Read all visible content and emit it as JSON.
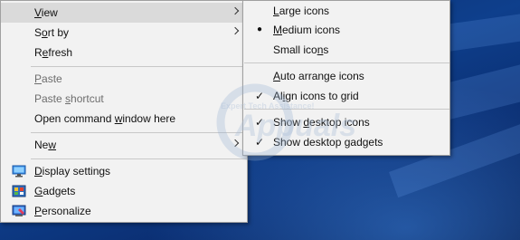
{
  "context_menu": {
    "items": [
      {
        "label": "View",
        "mn": "V",
        "rest": "iew",
        "arrow": true,
        "hover": true
      },
      {
        "label": "Sort by",
        "mn": "o",
        "pre": "S",
        "rest": "rt by",
        "arrow": true
      },
      {
        "label": "Refresh",
        "mn": "e",
        "pre": "R",
        "rest": "fresh"
      },
      {
        "label": "Paste",
        "mn": "P",
        "rest": "aste",
        "disabled": true
      },
      {
        "label": "Paste shortcut",
        "mn": "s",
        "pre": "Paste ",
        "rest": "hortcut",
        "disabled": true
      },
      {
        "label": "Open command window here",
        "mn": "w",
        "pre": "Open command ",
        "rest": "indow here"
      },
      {
        "label": "New",
        "mn": "w",
        "pre": "Ne",
        "rest": "",
        "arrow": true
      },
      {
        "label": "Display settings",
        "mn": "D",
        "rest": "isplay settings",
        "icon": "display-icon"
      },
      {
        "label": "Gadgets",
        "mn": "G",
        "rest": "adgets",
        "icon": "gadgets-icon"
      },
      {
        "label": "Personalize",
        "mn": "P",
        "rest": "ersonalize",
        "icon": "personalize-icon"
      }
    ]
  },
  "view_submenu": {
    "items": [
      {
        "label": "Large icons",
        "pre": "",
        "mn": "L",
        "rest": "arge icons",
        "mark": ""
      },
      {
        "label": "Medium icons",
        "pre": "",
        "mn": "M",
        "rest": "edium icons",
        "mark": "●"
      },
      {
        "label": "Small icons",
        "pre": "Small ico",
        "mn": "n",
        "rest": "s",
        "mark": ""
      },
      {
        "label": "Auto arrange icons",
        "pre": "",
        "mn": "A",
        "rest": "uto arrange icons",
        "mark": ""
      },
      {
        "label": "Align icons to grid",
        "pre": "Al",
        "mn": "i",
        "rest": "gn icons to grid",
        "mark": "✓"
      },
      {
        "label": "Show desktop icons",
        "pre": "Show ",
        "mn": "d",
        "rest": "esktop icons",
        "mark": "✓"
      },
      {
        "label": "Show desktop gadgets",
        "pre": "Show desktop ",
        "mn": "g",
        "rest": "adgets",
        "mark": "✓"
      }
    ]
  },
  "watermark": {
    "brand": "Appuals",
    "tagline": "Expert Tech Assistance!"
  },
  "colors": {
    "desktop": "#0e3f8c",
    "menu_bg": "#f2f2f2",
    "hover": "#dadada",
    "disabled": "#6d6d6d"
  }
}
